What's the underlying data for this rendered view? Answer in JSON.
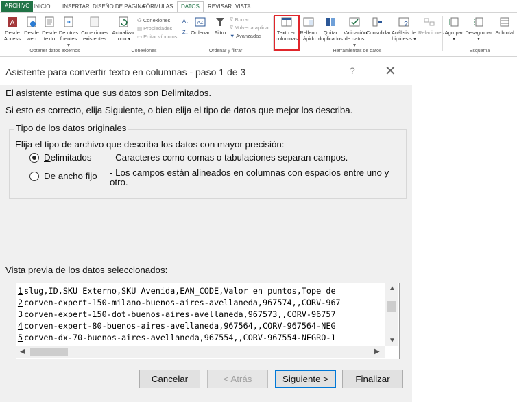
{
  "ribbon": {
    "tabs": [
      "ARCHIVO",
      "INICIO",
      "INSERTAR",
      "DISEÑO DE PÁGINA",
      "FÓRMULAS",
      "DATOS",
      "REVISAR",
      "VISTA"
    ],
    "active_tab": "DATOS",
    "external_data": {
      "access": [
        "Desde",
        "Access"
      ],
      "web": [
        "Desde",
        "web"
      ],
      "text": [
        "Desde",
        "texto"
      ],
      "other": [
        "De otras",
        "fuentes ▾"
      ],
      "existing": [
        "Conexiones",
        "existentes"
      ],
      "group_label": "Obtener datos externos"
    },
    "connections": {
      "refresh": [
        "Actualizar",
        "todo ▾"
      ],
      "connections": "Conexiones",
      "properties": "Propiedades",
      "edit_links": "Editar vínculos",
      "group_label": "Conexiones"
    },
    "sort_filter": {
      "sort": "Ordenar",
      "filter": "Filtro",
      "clear": "Borrar",
      "reapply": "Volver a aplicar",
      "advanced": "Avanzadas",
      "group_label": "Ordenar y filtrar"
    },
    "data_tools": {
      "text_to_columns": [
        "Texto en",
        "columnas"
      ],
      "flash_fill": [
        "Relleno",
        "rápido"
      ],
      "remove_duplicates": [
        "Quitar",
        "duplicados"
      ],
      "validation": [
        "Validación",
        "de datos ▾"
      ],
      "consolidate": "Consolidar",
      "what_if": [
        "Análisis de",
        "hipótesis ▾"
      ],
      "relationships": "Relaciones",
      "group_label": "Herramientas de datos"
    },
    "outline": {
      "group": [
        "Agrupar",
        "▾"
      ],
      "ungroup": [
        "Desagrupar",
        "▾"
      ],
      "subtotal": "Subtotal",
      "group_label": "Esquema"
    }
  },
  "dialog": {
    "title": "Asistente para convertir texto en columnas - paso 1 de 3",
    "help": "?",
    "close": "✕",
    "line1": "El asistente estima que sus datos son Delimitados.",
    "line2": "Si esto es correcto, elija Siguiente, o bien elija el tipo de datos que mejor los describa.",
    "group_title": "Tipo de los datos originales",
    "group_prompt": "Elija el tipo de archivo que describa los datos con mayor precisión:",
    "option_delimited": {
      "pre": "",
      "accel": "D",
      "post": "elimitados",
      "desc": "- Caracteres como comas o tabulaciones separan campos.",
      "selected": true
    },
    "option_fixed": {
      "pre": "De ",
      "accel": "a",
      "post": "ncho fijo",
      "desc": "- Los campos están alineados en columnas con espacios entre uno y otro.",
      "selected": false
    },
    "preview_label": "Vista previa de los datos seleccionados:",
    "preview_rows": [
      {
        "n": "1",
        "text": "slug,ID,SKU Externo,SKU Avenida,EAN_CODE,Valor en puntos,Tope de"
      },
      {
        "n": "2",
        "text": "corven-expert-150-milano-buenos-aires-avellaneda,967574,,CORV-967"
      },
      {
        "n": "3",
        "text": "corven-expert-150-dot-buenos-aires-avellaneda,967573,,CORV-96757"
      },
      {
        "n": "4",
        "text": "corven-expert-80-buenos-aires-avellaneda,967564,,CORV-967564-NEG"
      },
      {
        "n": "5",
        "text": "corven-dx-70-buenos-aires-avellaneda,967554,,CORV-967554-NEGRO-1"
      }
    ],
    "buttons": {
      "cancel": "Cancelar",
      "back": "< Atrás",
      "next_accel": "S",
      "next_rest": "iguiente >",
      "finish_accel": "F",
      "finish_rest": "inalizar"
    }
  }
}
